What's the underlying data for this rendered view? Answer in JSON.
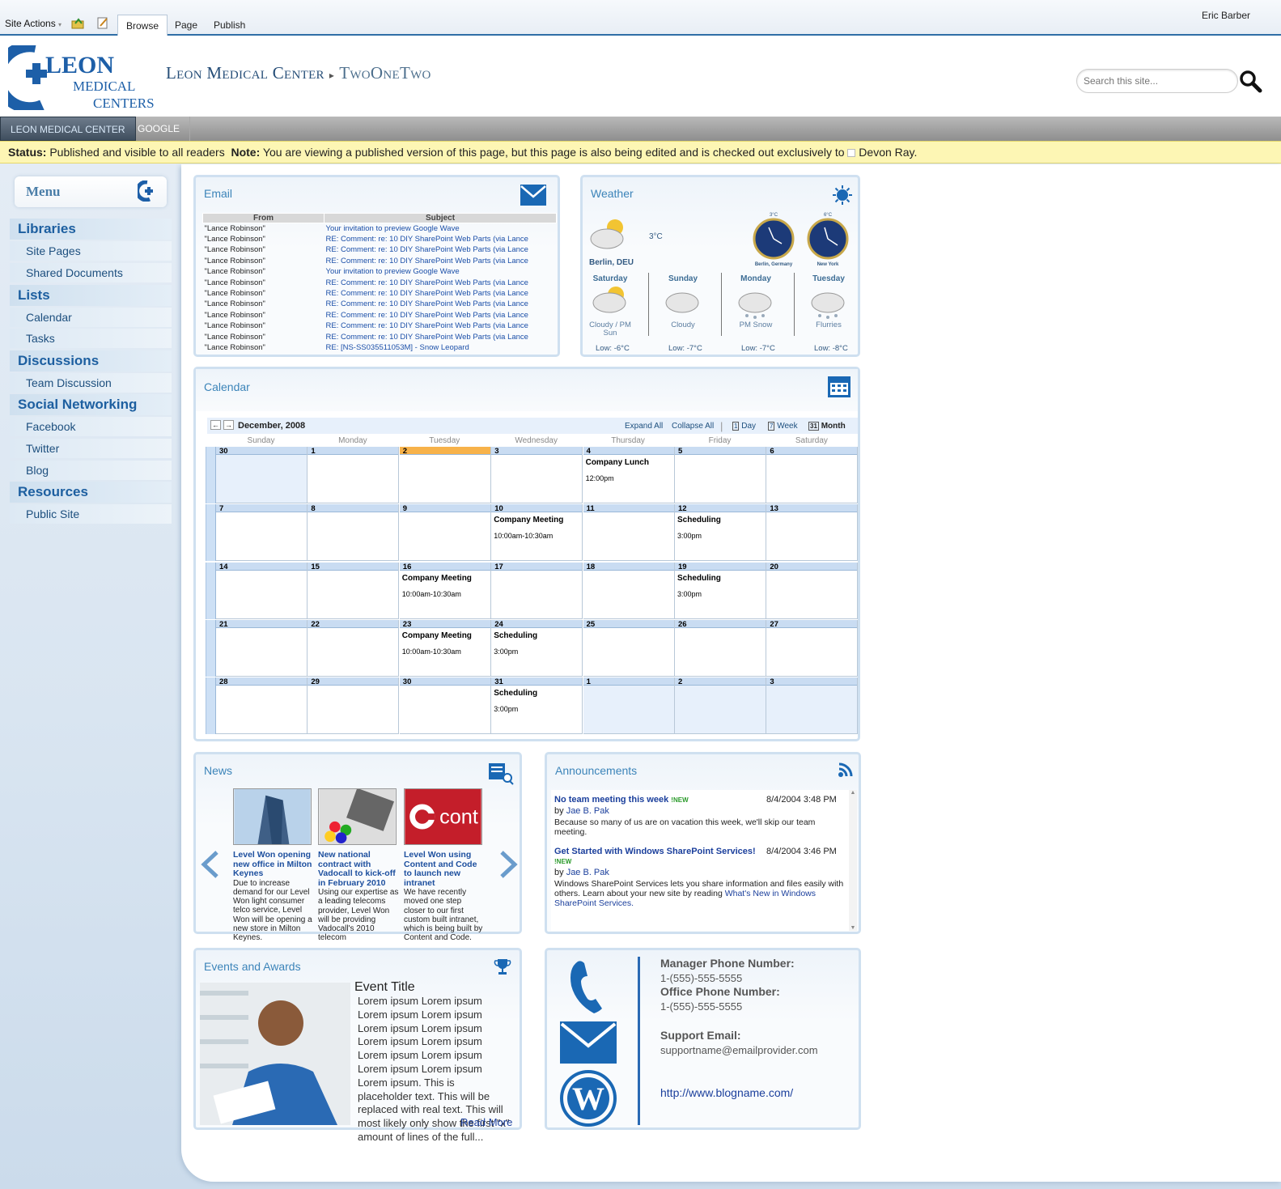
{
  "ribbon": {
    "site_actions": "Site Actions",
    "tabs": [
      "Browse",
      "Page",
      "Publish"
    ],
    "user": "Eric Barber"
  },
  "header": {
    "logo": {
      "line1": "LEON",
      "line2": "MEDICAL",
      "line3": "CENTERS"
    },
    "site": "Leon Medical Center",
    "page": "TwoOneTwo",
    "search_placeholder": "Search this site..."
  },
  "topnav": [
    "LEON MEDICAL CENTER",
    "GOOGLE"
  ],
  "status": {
    "label": "Status:",
    "text": "Published and visible to all readers",
    "note_label": "Note:",
    "note": "You are viewing a published version of this page, but this page is also being edited and is checked out exclusively to",
    "user": "Devon Ray."
  },
  "sidebar": {
    "title": "Menu",
    "sections": [
      {
        "h": "Libraries",
        "items": [
          "Site Pages",
          "Shared Documents"
        ]
      },
      {
        "h": "Lists",
        "items": [
          "Calendar",
          "Tasks"
        ]
      },
      {
        "h": "Discussions",
        "items": [
          "Team Discussion"
        ]
      },
      {
        "h": "Social Networking",
        "items": [
          "Facebook",
          "Twitter",
          "Blog"
        ]
      },
      {
        "h": "Resources",
        "items": [
          "Public Site"
        ]
      }
    ]
  },
  "email": {
    "title": "Email",
    "cols": [
      "From",
      "Subject"
    ],
    "rows": [
      [
        "\"Lance Robinson\"",
        "Your invitation to preview Google Wave"
      ],
      [
        "\"Lance Robinson\"",
        "RE: Comment: re: 10 DIY SharePoint Web Parts (via Lance"
      ],
      [
        "\"Lance Robinson\"",
        "RE: Comment: re: 10 DIY SharePoint Web Parts (via Lance"
      ],
      [
        "\"Lance Robinson\"",
        "RE: Comment: re: 10 DIY SharePoint Web Parts (via Lance"
      ],
      [
        "\"Lance Robinson\"",
        "Your invitation to preview Google Wave"
      ],
      [
        "\"Lance Robinson\"",
        "RE: Comment: re: 10 DIY SharePoint Web Parts (via Lance"
      ],
      [
        "\"Lance Robinson\"",
        "RE: Comment: re: 10 DIY SharePoint Web Parts (via Lance"
      ],
      [
        "\"Lance Robinson\"",
        "RE: Comment: re: 10 DIY SharePoint Web Parts (via Lance"
      ],
      [
        "\"Lance Robinson\"",
        "RE: Comment: re: 10 DIY SharePoint Web Parts (via Lance"
      ],
      [
        "\"Lance Robinson\"",
        "RE: Comment: re: 10 DIY SharePoint Web Parts (via Lance"
      ],
      [
        "\"Lance Robinson\"",
        "RE: Comment: re: 10 DIY SharePoint Web Parts (via Lance"
      ],
      [
        "\"Lance Robinson\"",
        "RE: [NS-SS035511053M] - Snow Leopard"
      ]
    ]
  },
  "weather": {
    "title": "Weather",
    "temp": "3°C",
    "city": "Berlin, DEU",
    "clocks": [
      {
        "temp": "3°C",
        "city": "Berlin, Germany"
      },
      {
        "temp": "6°C",
        "city": "New York"
      }
    ],
    "days": [
      {
        "d": "Saturday",
        "c": "Cloudy / PM Sun",
        "low": "Low: -6°C"
      },
      {
        "d": "Sunday",
        "c": "Cloudy",
        "low": "Low: -7°C"
      },
      {
        "d": "Monday",
        "c": "PM Snow",
        "low": "Low: -7°C"
      },
      {
        "d": "Tuesday",
        "c": "Flurries",
        "low": "Low: -8°C"
      }
    ]
  },
  "calendar": {
    "title": "Calendar",
    "month": "December, 2008",
    "expand": "Expand All",
    "collapse": "Collapse All",
    "views": [
      "Day",
      "Week",
      "Month"
    ],
    "dow": [
      "Sunday",
      "Monday",
      "Tuesday",
      "Wednesday",
      "Thursday",
      "Friday",
      "Saturday"
    ],
    "weeks": [
      [
        {
          "n": "30",
          "o": true
        },
        {
          "n": "1"
        },
        {
          "n": "2",
          "today": true
        },
        {
          "n": "3"
        },
        {
          "n": "4",
          "ev": "Company Lunch",
          "t": "12:00pm"
        },
        {
          "n": "5"
        },
        {
          "n": "6"
        }
      ],
      [
        {
          "n": "7"
        },
        {
          "n": "8"
        },
        {
          "n": "9"
        },
        {
          "n": "10",
          "ev": "Company Meeting",
          "t": "10:00am-10:30am"
        },
        {
          "n": "11"
        },
        {
          "n": "12",
          "ev": "Scheduling",
          "t": "3:00pm"
        },
        {
          "n": "13"
        }
      ],
      [
        {
          "n": "14"
        },
        {
          "n": "15"
        },
        {
          "n": "16",
          "ev": "Company Meeting",
          "t": "10:00am-10:30am"
        },
        {
          "n": "17"
        },
        {
          "n": "18"
        },
        {
          "n": "19",
          "ev": "Scheduling",
          "t": "3:00pm"
        },
        {
          "n": "20"
        }
      ],
      [
        {
          "n": "21"
        },
        {
          "n": "22"
        },
        {
          "n": "23",
          "ev": "Company Meeting",
          "t": "10:00am-10:30am"
        },
        {
          "n": "24",
          "ev": "Scheduling",
          "t": "3:00pm"
        },
        {
          "n": "25"
        },
        {
          "n": "26"
        },
        {
          "n": "27"
        }
      ],
      [
        {
          "n": "28"
        },
        {
          "n": "29"
        },
        {
          "n": "30"
        },
        {
          "n": "31",
          "ev": "Scheduling",
          "t": "3:00pm"
        },
        {
          "n": "1",
          "o": true
        },
        {
          "n": "2",
          "o": true
        },
        {
          "n": "3",
          "o": true
        }
      ]
    ]
  },
  "news": {
    "title": "News",
    "items": [
      {
        "t": "Level Won opening new office in Milton Keynes",
        "b": "Due to increase demand for our Level Won light consumer telco service, Level Won will be opening a new store in Milton Keynes."
      },
      {
        "t": "New national contract with Vadocall to kick-off in February 2010",
        "b": "Using our expertise as a leading telecoms provider, Level Won will be providing Vadocall's 2010 telecom"
      },
      {
        "t": "Level Won using Content and Code to launch new intranet",
        "b": "We have recently moved one step closer to our first custom built intranet, which is being built by Content and Code."
      }
    ],
    "img3_text": "cont"
  },
  "announcements": {
    "title": "Announcements",
    "items": [
      {
        "t": "No team meeting this week",
        "new": "NEW",
        "date": "8/4/2004 3:48 PM",
        "by": "by",
        "author": "Jae B. Pak",
        "b": "Because so many of us are on vacation this week, we'll skip our team meeting."
      },
      {
        "t": "Get Started with Windows SharePoint Services!",
        "new": "NEW",
        "date": "8/4/2004 3:46 PM",
        "by": "by",
        "author": "Jae B. Pak",
        "b": "Windows SharePoint Services lets you share information and files easily with others. Learn about your new site by reading",
        "link": "What's New in Windows SharePoint Services."
      }
    ]
  },
  "events": {
    "title": "Events and Awards",
    "event_title": "Event Title",
    "body": "Lorem ipsum Lorem ipsum Lorem ipsum Lorem ipsum Lorem ipsum Lorem ipsum Lorem ipsum Lorem ipsum Lorem ipsum Lorem ipsum Lorem ipsum Lorem ipsum Lorem ipsum. This is placeholder text. This will be replaced with real text. This will most likely only show the first \"x\" amount of lines of the full...",
    "dot": ".",
    "read_more": "Read More"
  },
  "contact": {
    "mgr_label": "Manager Phone Number:",
    "mgr": "1-(555)-555-5555",
    "office_label": "Office Phone Number:",
    "office": "1-(555)-555-5555",
    "support_label": "Support Email:",
    "support": "supportname@emailprovider.com",
    "blog": "http://www.blogname.com/"
  },
  "colors": {
    "accent": "#2f6ea6",
    "status_bg": "#fdf6b4",
    "today": "#f7b24a"
  }
}
